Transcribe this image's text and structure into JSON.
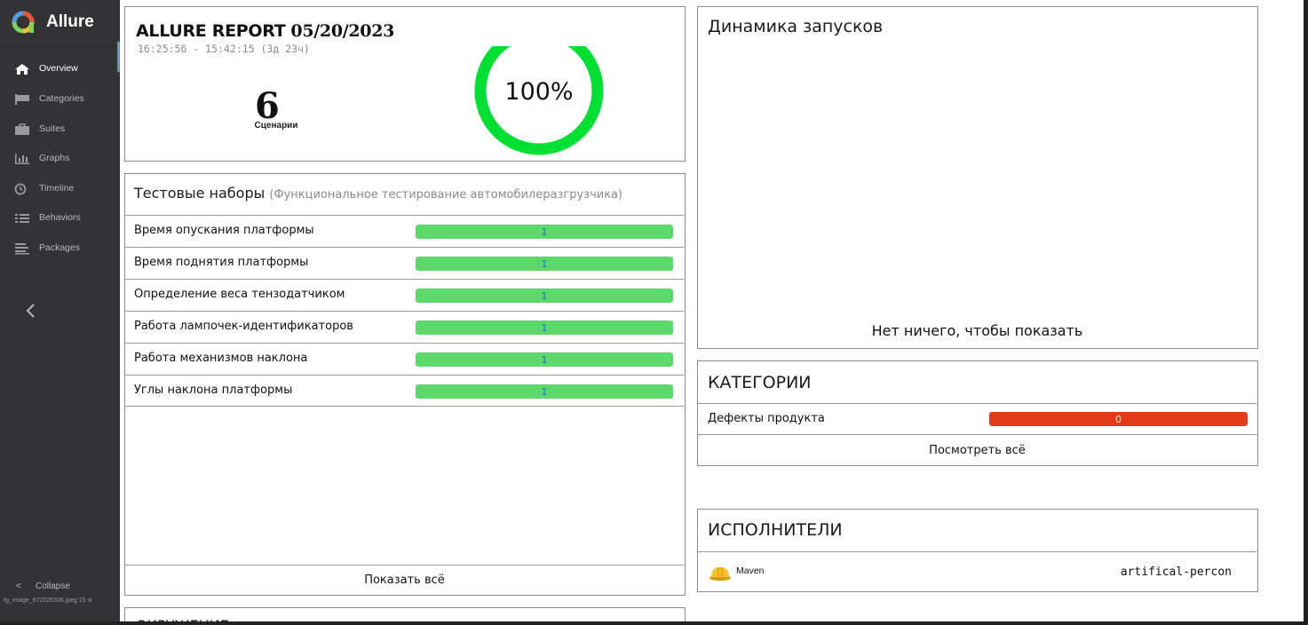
{
  "app": {
    "name": "Allure"
  },
  "colors": {
    "sidebar_bg": "#333336",
    "pass_green": "#5cd96a",
    "donut_green": "#00e032",
    "defect_red": "#e43b1a",
    "accent": "#6d8ec1"
  },
  "sidebar": {
    "items": [
      {
        "label": "Overview",
        "icon": "home-icon",
        "active": true
      },
      {
        "label": "Categories",
        "icon": "flag-icon",
        "active": false
      },
      {
        "label": "Suites",
        "icon": "briefcase-icon",
        "active": false
      },
      {
        "label": "Graphs",
        "icon": "bar-chart-icon",
        "active": false
      },
      {
        "label": "Timeline",
        "icon": "clock-icon",
        "active": false
      },
      {
        "label": "Behaviors",
        "icon": "list-icon",
        "active": false
      },
      {
        "label": "Packages",
        "icon": "packages-icon",
        "active": false
      }
    ],
    "collapse_label": "Collapse",
    "filename": "tg_image_872025306.jpeg 15 sl"
  },
  "summary": {
    "title": "ALLURE REPORT",
    "date": "05/20/2023",
    "time_range": "16:25:56 - 15:42:15 (3д 23ч)",
    "count": "6",
    "count_label": "Сценарии",
    "percent": "100%",
    "pass_fraction": 1.0
  },
  "suites": {
    "title": "Тестовые наборы",
    "subtitle": "(Функциональное тестирование автомобилеразгрузчика)",
    "rows": [
      {
        "name": "Время опускания платформы",
        "value": "1"
      },
      {
        "name": "Время поднятия платформы",
        "value": "1"
      },
      {
        "name": "Определение веса тензодатчиком",
        "value": "1"
      },
      {
        "name": "Работа лампочек-идентификаторов",
        "value": "1"
      },
      {
        "name": "Работа механизмов наклона",
        "value": "1"
      },
      {
        "name": "Углы наклона платформы",
        "value": "1"
      }
    ],
    "show_all": "Показать всё"
  },
  "environment": {
    "title": "ОКРУЖЕНИЕ"
  },
  "trend": {
    "title": "Динамика запусков",
    "empty": "Нет ничего, чтобы показать"
  },
  "categories": {
    "title": "КАТЕГОРИИ",
    "rows": [
      {
        "name": "Дефекты продукта",
        "value": "0"
      }
    ],
    "view_all": "Посмотреть всё"
  },
  "executors": {
    "title": "ИСПОЛНИТЕЛИ",
    "rows": [
      {
        "name": "Maven",
        "build": "artifical-percon",
        "icon": "hard-hat-icon"
      }
    ]
  }
}
